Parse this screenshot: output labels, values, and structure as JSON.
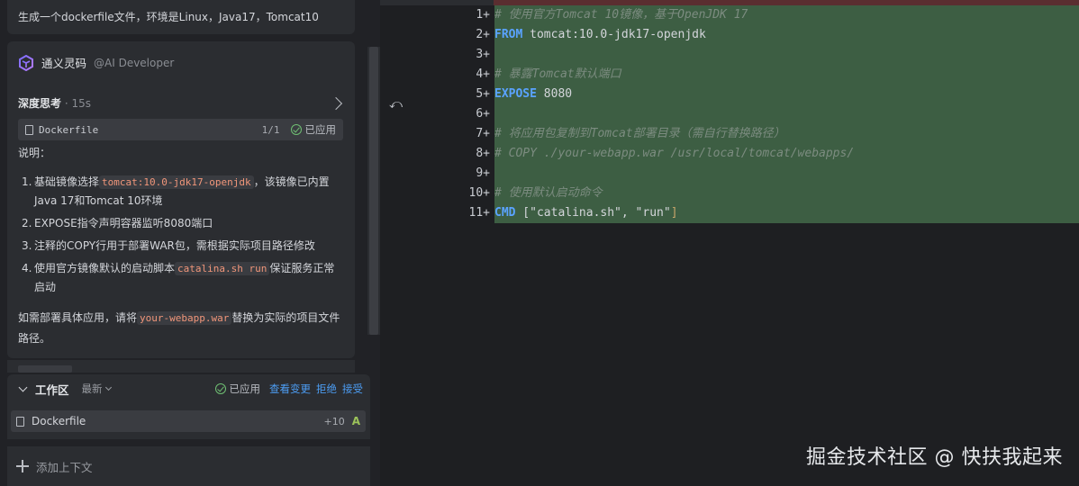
{
  "chat": {
    "user_message": "生成一个dockerfile文件，环境是Linux，Java17，Tomcat10",
    "ai_name": "通义灵码",
    "ai_role": "@AI Developer",
    "think_title": "深度思考",
    "think_time": " · 15s",
    "file_chip": {
      "name": "Dockerfile",
      "count": "1/1",
      "status": "已应用"
    },
    "explain_label": "说明：",
    "steps": [
      {
        "num": "1.",
        "pre": "基础镜像选择",
        "code": "tomcat:10.0-jdk17-openjdk",
        "post": "，该镜像已内置Java 17和Tomcat 10环境"
      },
      {
        "num": "2.",
        "pre": "EXPOSE指令声明容器监听8080端口",
        "code": "",
        "post": ""
      },
      {
        "num": "3.",
        "pre": "注释的COPY行用于部署WAR包，需根据实际项目路径修改",
        "code": "",
        "post": ""
      },
      {
        "num": "4.",
        "pre": "使用官方镜像默认的启动脚本",
        "code": "catalina.sh run",
        "post": "保证服务正常启动"
      }
    ],
    "footer_pre": "如需部署具体应用，请将",
    "footer_code": "your-webapp.war",
    "footer_post": "替换为实际的项目文件路径。"
  },
  "workzone": {
    "title": "工作区",
    "sort": "最新",
    "status": "已应用",
    "view_changes": "查看变更",
    "reject": "拒绝",
    "accept": "接受",
    "file_name": "Dockerfile",
    "file_diff": "+10",
    "file_badge": "A"
  },
  "add_context": "添加上下文",
  "editor": {
    "lines": [
      {
        "n": "1+",
        "segments": [
          {
            "t": "# 使用官方Tomcat 10镜像，基于OpenJDK 17",
            "c": "comment"
          }
        ]
      },
      {
        "n": "2+",
        "segments": [
          {
            "t": "FROM",
            "c": "kw"
          },
          {
            "t": " tomcat:10.0-jdk17-openjdk",
            "c": "plain"
          }
        ]
      },
      {
        "n": "3+",
        "segments": []
      },
      {
        "n": "4+",
        "segments": [
          {
            "t": "# 暴露Tomcat默认端口",
            "c": "comment"
          }
        ]
      },
      {
        "n": "5+",
        "segments": [
          {
            "t": "EXPOSE",
            "c": "kw"
          },
          {
            "t": " 8080",
            "c": "plain"
          }
        ]
      },
      {
        "n": "6+",
        "segments": []
      },
      {
        "n": "7+",
        "segments": [
          {
            "t": "# 将应用包复制到Tomcat部署目录（需自行替换路径）",
            "c": "comment"
          }
        ]
      },
      {
        "n": "8+",
        "segments": [
          {
            "t": "# COPY ./your-webapp.war /usr/local/tomcat/webapps/",
            "c": "comment"
          }
        ]
      },
      {
        "n": "9+",
        "segments": []
      },
      {
        "n": "10+",
        "segments": [
          {
            "t": "# 使用默认启动命令",
            "c": "comment"
          }
        ]
      },
      {
        "n": "11+",
        "segments": [
          {
            "t": "CMD",
            "c": "kw"
          },
          {
            "t": " [",
            "c": "plain"
          },
          {
            "t": "\"catalina.sh\"",
            "c": "str"
          },
          {
            "t": ", ",
            "c": "plain"
          },
          {
            "t": "\"run\"",
            "c": "str"
          },
          {
            "t": "]",
            "c": "br"
          }
        ]
      }
    ]
  },
  "watermark": "掘金技术社区 @ 快扶我起来",
  "colors": {
    "added_bg": "#3d5e43",
    "keyword": "#5aa3ff",
    "comment": "#7c8c80",
    "link": "#4c9df3",
    "code_inline": "#f1967a"
  }
}
